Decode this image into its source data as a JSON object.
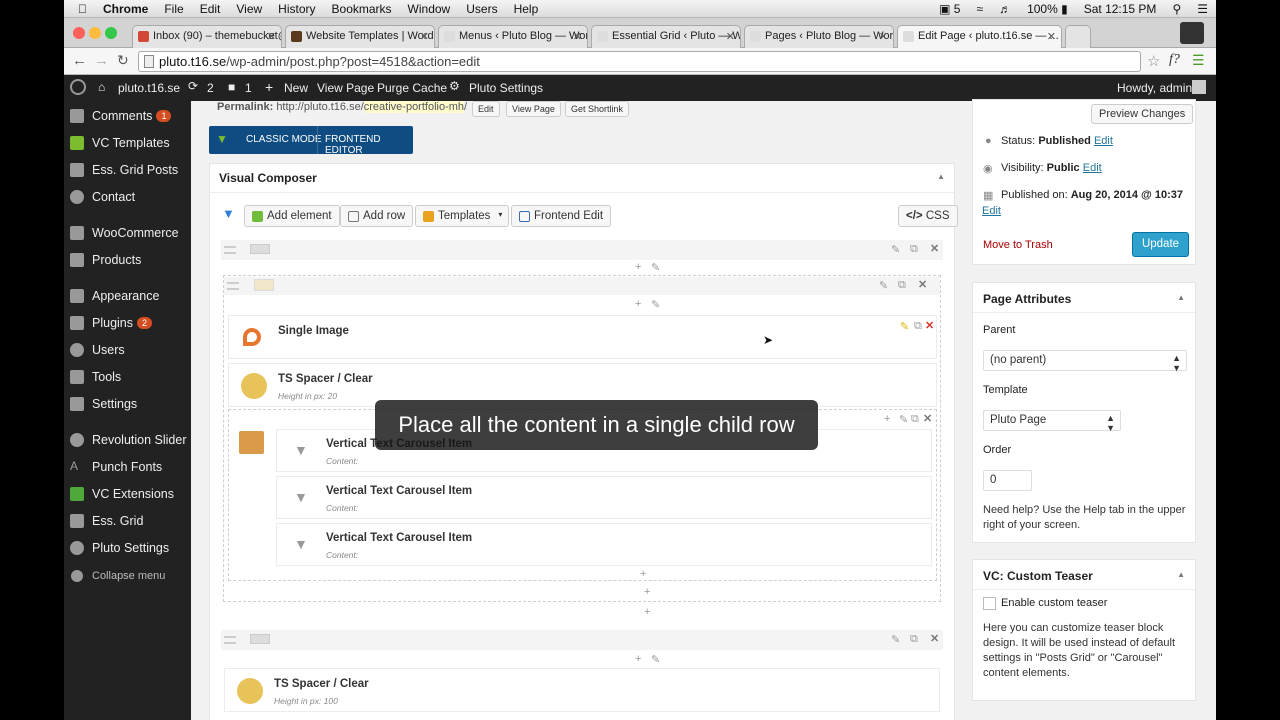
{
  "mac_menu": {
    "app": "Chrome",
    "items": [
      "File",
      "Edit",
      "View",
      "History",
      "Bookmarks",
      "Window",
      "Users",
      "Help"
    ],
    "status": {
      "battery": "100%",
      "clock": "Sat 12:15 PM",
      "notify_count": "5"
    }
  },
  "tabs": [
    {
      "label": "Inbox (90) – themebucket@..."
    },
    {
      "label": "Website Templates | Word..."
    },
    {
      "label": "Menus ‹ Pluto Blog — Word..."
    },
    {
      "label": "Essential Grid ‹ Pluto — W..."
    },
    {
      "label": "Pages ‹ Pluto Blog — Word..."
    },
    {
      "label": "Edit Page ‹ pluto.t16.se — ..."
    }
  ],
  "address": {
    "host": "pluto.t16.se",
    "path": "/wp-admin/post.php?post=4518&action=edit"
  },
  "admin_bar": {
    "site": "pluto.t16.se",
    "updates": "2",
    "comments": "1",
    "new": "New",
    "view_page": "View Page",
    "purge": "Purge Cache",
    "settings": "Pluto Settings",
    "howdy": "Howdy, admin"
  },
  "sidebar": {
    "items": [
      {
        "label": "Comments",
        "badge": "1"
      },
      {
        "label": "VC Templates"
      },
      {
        "label": "Ess. Grid Posts"
      },
      {
        "label": "Contact"
      },
      {
        "label": "WooCommerce"
      },
      {
        "label": "Products"
      },
      {
        "label": "Appearance"
      },
      {
        "label": "Plugins",
        "badge": "2"
      },
      {
        "label": "Users"
      },
      {
        "label": "Tools"
      },
      {
        "label": "Settings"
      },
      {
        "label": "Revolution Slider"
      },
      {
        "label": "Punch Fonts"
      },
      {
        "label": "VC Extensions"
      },
      {
        "label": "Ess. Grid"
      },
      {
        "label": "Pluto Settings"
      },
      {
        "label": "Collapse menu"
      }
    ]
  },
  "permalink": {
    "label": "Permalink:",
    "base": "http://pluto.t16.se/",
    "slug": "creative-portfolio-mh",
    "slash": "/",
    "edit": "Edit",
    "view": "View Page",
    "shortlink": "Get Shortlink"
  },
  "modes": {
    "classic": "CLASSIC MODE",
    "frontend": "FRONTEND EDITOR"
  },
  "vc": {
    "title": "Visual Composer",
    "add_element": "Add element",
    "add_row": "Add row",
    "templates": "Templates",
    "frontend_edit": "Frontend Edit",
    "css": "CSS"
  },
  "elements": {
    "single_image": "Single Image",
    "spacer1_title": "TS Spacer / Clear",
    "spacer1_sub": "Height in px: 20",
    "carousel": [
      {
        "title": "Vertical Text Carousel Item",
        "sub": "Content:"
      },
      {
        "title": "Vertical Text Carousel Item",
        "sub": "Content:"
      },
      {
        "title": "Vertical Text Carousel Item",
        "sub": "Content:"
      }
    ],
    "spacer2_title": "TS Spacer / Clear",
    "spacer2_sub": "Height in px: 100"
  },
  "publish": {
    "preview": "Preview Changes",
    "status_label": "Status:",
    "status_val": "Published",
    "visibility_label": "Visibility:",
    "visibility_val": "Public",
    "published_label": "Published on:",
    "published_val": "Aug 20, 2014 @ 10:37",
    "edit": "Edit",
    "trash": "Move to Trash",
    "update": "Update"
  },
  "page_attributes": {
    "title": "Page Attributes",
    "parent_label": "Parent",
    "parent_val": "(no parent)",
    "template_label": "Template",
    "template_val": "Pluto Page",
    "order_label": "Order",
    "order_val": "0",
    "help": "Need help? Use the Help tab in the upper right of your screen."
  },
  "teaser": {
    "title": "VC: Custom Teaser",
    "checkbox": "Enable custom teaser",
    "desc": "Here you can customize teaser block design. It will be used instead of default settings in \"Posts Grid\" or \"Carousel\" content elements."
  },
  "caption": "Place all the content in a single child row",
  "colors": {
    "wp_dark": "#222222",
    "update_blue": "#2ea2cc",
    "vc_blue": "#0f4c81",
    "trash_red": "#a00000"
  }
}
